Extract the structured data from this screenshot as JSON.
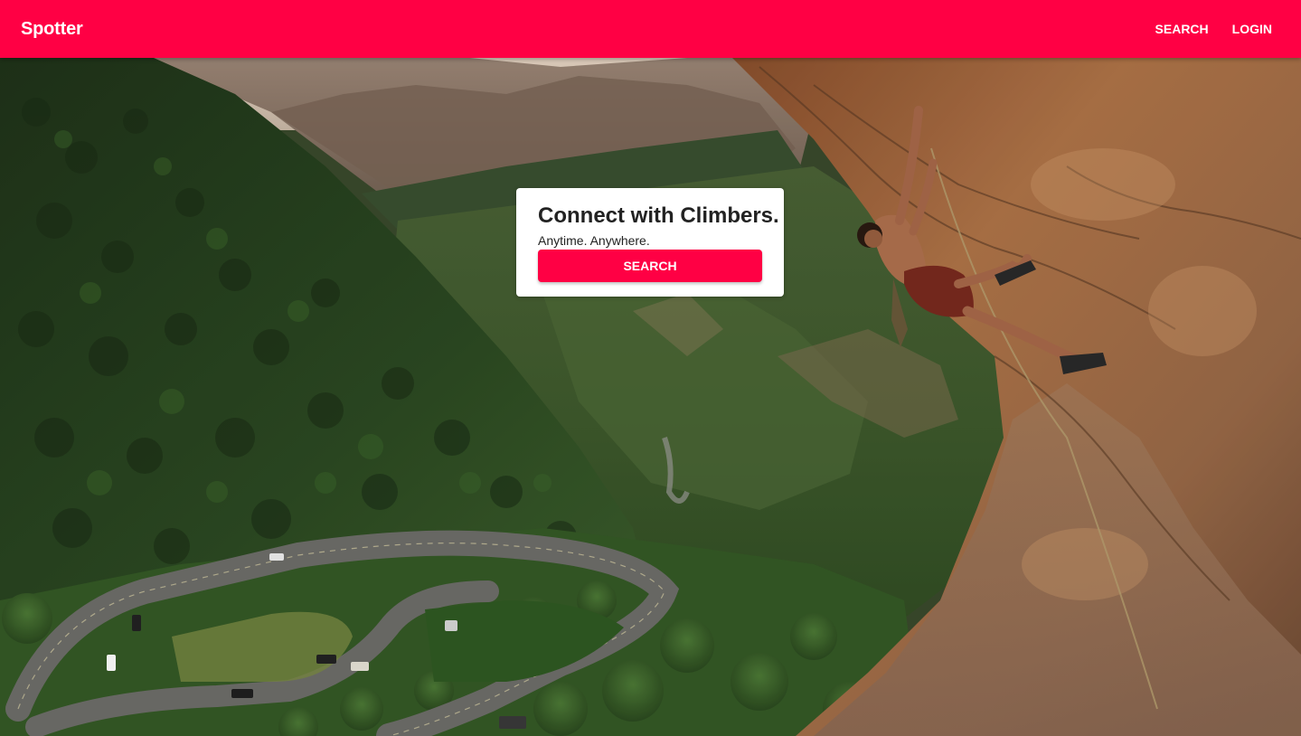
{
  "header": {
    "brand": "Spotter",
    "nav": {
      "search_label": "SEARCH",
      "login_label": "LOGIN"
    }
  },
  "hero_card": {
    "title": "Connect with Climbers.",
    "subtitle": "Anytime. Anywhere.",
    "button_label": "SEARCH"
  },
  "colors": {
    "brand": "#ff0044",
    "card_background": "#ffffff"
  }
}
